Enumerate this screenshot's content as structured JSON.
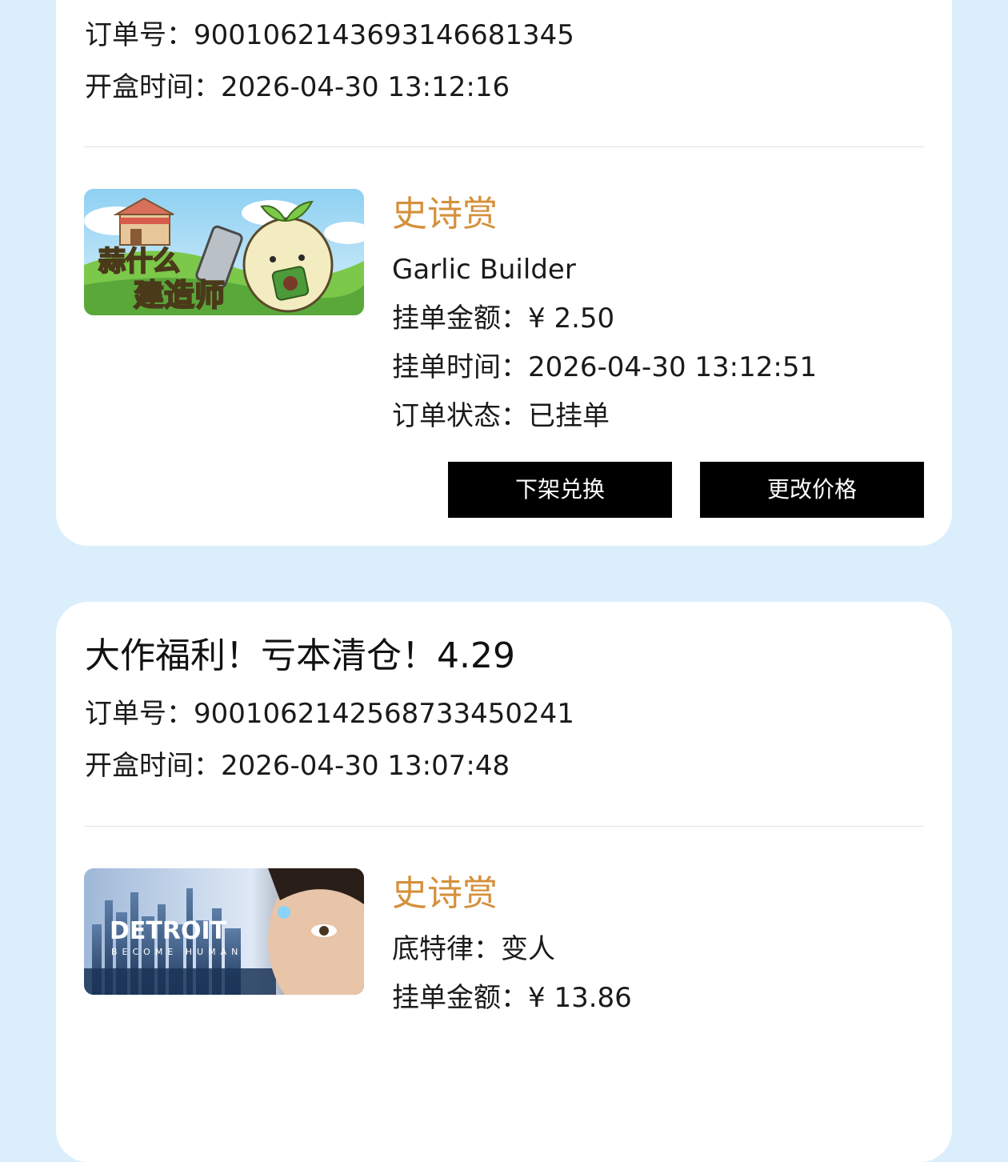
{
  "orders": [
    {
      "order_label": "订单号：",
      "order_no": "9001062143693146681345",
      "open_label": "开盒时间：",
      "open_time": "2026-04-30 13:12:16",
      "item": {
        "rarity": "史诗赏",
        "name": "Garlic Builder",
        "thumb_text_line1": "蒜什么",
        "thumb_text_line2": "建造师",
        "price_label": "挂单金额：",
        "price": "¥ 2.50",
        "list_time_label": "挂单时间：",
        "list_time": "2026-04-30 13:12:51",
        "status_label": "订单状态：",
        "status": "已挂单"
      },
      "buttons": {
        "delist": "下架兑换",
        "change_price": "更改价格"
      }
    },
    {
      "title": "大作福利！亏本清仓！4.29",
      "order_label": "订单号：",
      "order_no": "9001062142568733450241",
      "open_label": "开盒时间：",
      "open_time": "2026-04-30 13:07:48",
      "item": {
        "rarity": "史诗赏",
        "name": "底特律：变人",
        "thumb_text_line1": "DETROIT",
        "thumb_text_line2": "BECOME HUMAN",
        "price_label": "挂单金额：",
        "price": "¥ 13.86"
      }
    }
  ],
  "colors": {
    "background": "#dbeefc",
    "card": "#ffffff",
    "rarity": "#d4913c",
    "button": "#000000"
  }
}
